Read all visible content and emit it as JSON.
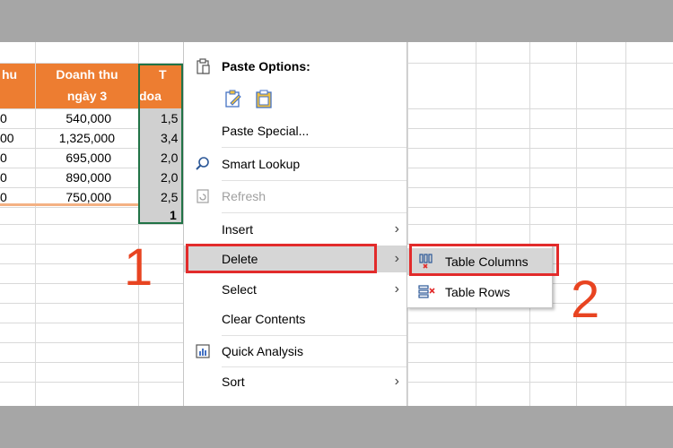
{
  "sheet": {
    "headers": [
      {
        "lines": [
          "hu",
          ""
        ]
      },
      {
        "lines": [
          "Doanh thu",
          "ngày 3"
        ]
      },
      {
        "lines": [
          "T",
          "doa"
        ]
      }
    ],
    "rows": [
      {
        "a": "0",
        "b": "540,000",
        "c": "1,5"
      },
      {
        "a": "00",
        "b": "1,325,000",
        "c": "3,4"
      },
      {
        "a": "0",
        "b": "695,000",
        "c": "2,0"
      },
      {
        "a": "0",
        "b": "890,000",
        "c": "2,0"
      },
      {
        "a": "0",
        "b": "750,000",
        "c": "2,5"
      }
    ],
    "total": "1"
  },
  "annotations": {
    "step1": "1",
    "step2": "2"
  },
  "context_menu": {
    "paste_options_label": "Paste Options:",
    "paste_special": "Paste Special...",
    "smart_lookup": "Smart Lookup",
    "refresh": "Refresh",
    "insert": "Insert",
    "delete": "Delete",
    "select": "Select",
    "clear_contents": "Clear Contents",
    "quick_analysis": "Quick Analysis",
    "sort": "Sort"
  },
  "submenu": {
    "table_columns": "Table Columns",
    "table_rows": "Table Rows"
  },
  "colors": {
    "header": "#ed7d31",
    "annotation_red": "#e22b2b",
    "selection_border": "#217346"
  }
}
